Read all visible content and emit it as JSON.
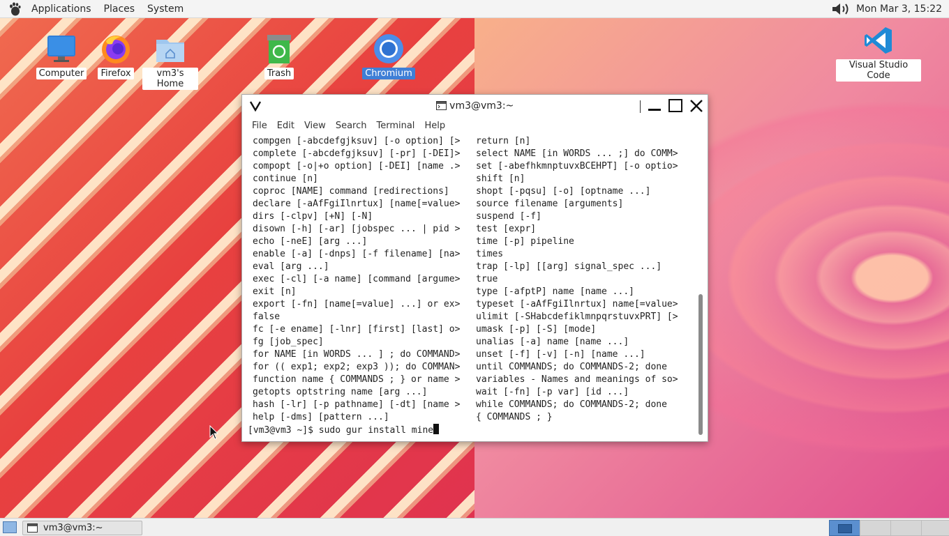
{
  "top_panel": {
    "menus": [
      "Applications",
      "Places",
      "System"
    ],
    "clock": "Mon Mar 3, 15:22"
  },
  "desktop": {
    "icons": [
      {
        "label": "Computer"
      },
      {
        "label": "Firefox"
      },
      {
        "label": "vm3's Home"
      },
      {
        "label": "Trash"
      },
      {
        "label": "Chromium"
      },
      {
        "label": "Visual Studio Code"
      }
    ]
  },
  "terminal": {
    "title": "vm3@vm3:~",
    "menu": [
      "File",
      "Edit",
      "View",
      "Search",
      "Terminal",
      "Help"
    ],
    "left_lines": [
      "compgen [-abcdefgjksuv] [-o option] [>",
      "complete [-abcdefgjksuv] [-pr] [-DEI]>",
      "compopt [-o|+o option] [-DEI] [name .>",
      "continue [n]",
      "coproc [NAME] command [redirections]",
      "declare [-aAfFgiIlnrtux] [name[=value>",
      "dirs [-clpv] [+N] [-N]",
      "disown [-h] [-ar] [jobspec ... | pid >",
      "echo [-neE] [arg ...]",
      "enable [-a] [-dnps] [-f filename] [na>",
      "eval [arg ...]",
      "exec [-cl] [-a name] [command [argume>",
      "exit [n]",
      "export [-fn] [name[=value] ...] or ex>",
      "false",
      "fc [-e ename] [-lnr] [first] [last] o>",
      "fg [job_spec]",
      "for NAME [in WORDS ... ] ; do COMMAND>",
      "for (( exp1; exp2; exp3 )); do COMMAN>",
      "function name { COMMANDS ; } or name >",
      "getopts optstring name [arg ...]",
      "hash [-lr] [-p pathname] [-dt] [name >",
      "help [-dms] [pattern ...]"
    ],
    "right_lines": [
      "return [n]",
      "select NAME [in WORDS ... ;] do COMM>",
      "set [-abefhkmnptuvxBCEHPT] [-o optio>",
      "shift [n]",
      "shopt [-pqsu] [-o] [optname ...]",
      "source filename [arguments]",
      "suspend [-f]",
      "test [expr]",
      "time [-p] pipeline",
      "times",
      "trap [-lp] [[arg] signal_spec ...]",
      "true",
      "type [-afptP] name [name ...]",
      "typeset [-aAfFgiIlnrtux] name[=value>",
      "ulimit [-SHabcdefiklmnpqrstuvxPRT] [>",
      "umask [-p] [-S] [mode]",
      "unalias [-a] name [name ...]",
      "unset [-f] [-v] [-n] [name ...]",
      "until COMMANDS; do COMMANDS-2; done",
      "variables - Names and meanings of so>",
      "wait [-fn] [-p var] [id ...]",
      "while COMMANDS; do COMMANDS-2; done",
      "{ COMMANDS ; }"
    ],
    "prompt": "[vm3@vm3 ~]$ ",
    "command_input": "sudo gur install mine"
  },
  "bottom_panel": {
    "task_label": "vm3@vm3:~"
  },
  "colors": {
    "selection_blue": "#3f7fd6",
    "panel_bg": "#f4f4f4"
  }
}
